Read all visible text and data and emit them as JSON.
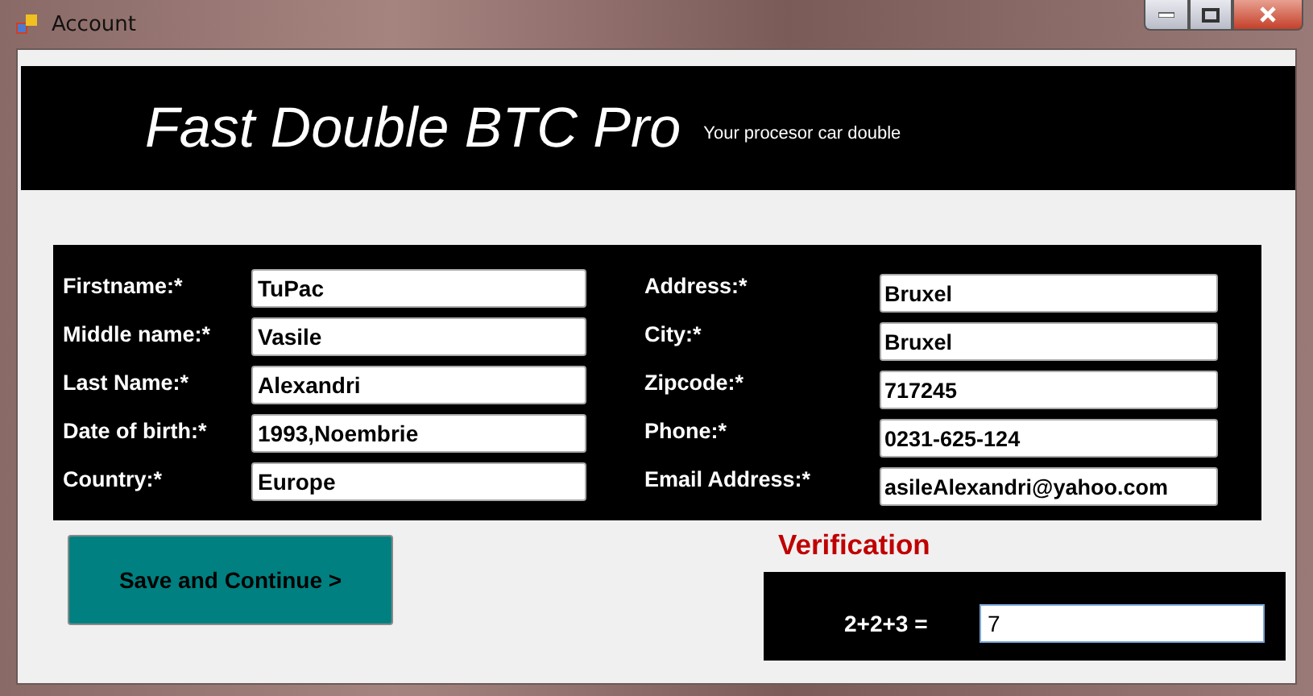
{
  "window": {
    "title": "Account"
  },
  "banner": {
    "title": "Fast Double BTC Pro",
    "subtitle": "Your procesor car double"
  },
  "form": {
    "left": [
      {
        "label": "Firstname:*",
        "value": "TuPac"
      },
      {
        "label": "Middle name:*",
        "value": "Vasile"
      },
      {
        "label": "Last Name:*",
        "value": "Alexandri"
      },
      {
        "label": "Date of birth:*",
        "value": "1993,Noembrie"
      },
      {
        "label": "Country:*",
        "value": "Europe"
      }
    ],
    "right": [
      {
        "label": "Address:*",
        "value": "Bruxel"
      },
      {
        "label": "City:*",
        "value": "Bruxel"
      },
      {
        "label": "Zipcode:*",
        "value": "717245"
      },
      {
        "label": "Phone:*",
        "value": "0231-625-124"
      },
      {
        "label": "Email Address:*",
        "value": "asileAlexandri@yahoo.com"
      }
    ]
  },
  "save_button": {
    "label": "Save and Continue >"
  },
  "verification": {
    "title": "Verification",
    "question": "2+2+3 =",
    "value": "7"
  }
}
